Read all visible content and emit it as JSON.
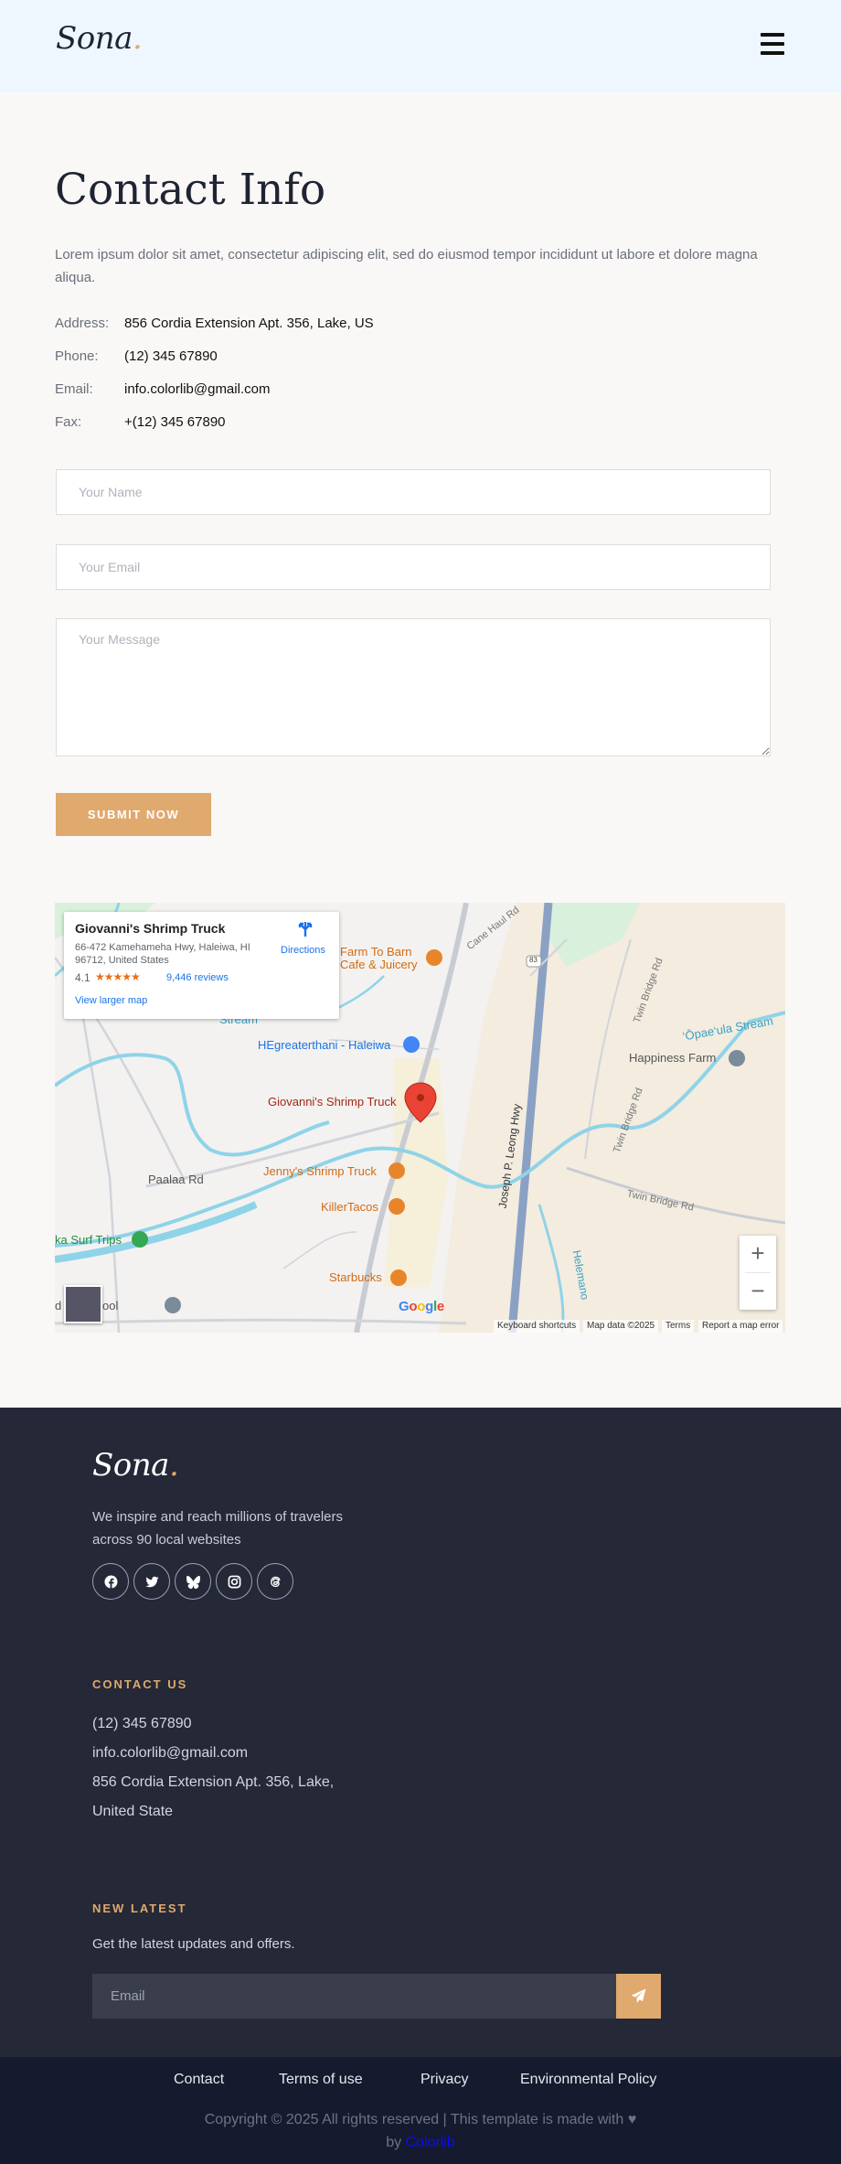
{
  "header": {
    "logo": "Sona",
    "logo_dot": "."
  },
  "contact": {
    "title": "Contact Info",
    "intro": "Lorem ipsum dolor sit amet, consectetur adipiscing elit, sed do eiusmod tempor incididunt ut labore et dolore magna aliqua.",
    "rows": [
      {
        "label": "Address:",
        "value": "856 Cordia Extension Apt. 356, Lake, US"
      },
      {
        "label": "Phone:",
        "value": "(12) 345 67890"
      },
      {
        "label": "Email:",
        "value": "info.colorlib@gmail.com"
      },
      {
        "label": "Fax:",
        "value": "+(12) 345 67890"
      }
    ]
  },
  "form": {
    "name_placeholder": "Your Name",
    "email_placeholder": "Your Email",
    "message_placeholder": "Your Message",
    "submit_label": "SUBMIT NOW"
  },
  "map": {
    "card": {
      "place": "Giovanni's Shrimp Truck",
      "address": "66-472 Kamehameha Hwy, Haleiwa, HI 96712, United States",
      "rating": "4.1",
      "stars": "★★★★★",
      "reviews": "9,446 reviews",
      "larger_map": "View larger map",
      "directions": "Directions"
    },
    "labels": {
      "farm_to_barn_1": "Farm To Barn",
      "farm_to_barn_2": "Cafe & Juicery",
      "cane_haul": "Cane Haul Rd",
      "twin_bridge_rd": "Twin Bridge Rd",
      "twin_bridge_rd2": "Twin Bridge Rd",
      "twin_bridge_rd3": "Twin Bridge Rd",
      "opaeula": "‘Ōpae‘ula Stream",
      "happiness": "Happiness Farm",
      "stream": "Stream",
      "hegreater": "HEgreaterthani - Haleiwa",
      "giovanni": "Giovanni's Shrimp Truck",
      "paalaa": "Paalaa Rd",
      "jenny": "Jenny's Shrimp Truck",
      "killer": "KillerTacos",
      "joseph": "Joseph P. Leong Hwy",
      "surf_trips": "ka Surf Trips",
      "starbucks": "Starbucks",
      "surf_school": "d    urf School",
      "helemano": "Helemano",
      "route": "83"
    },
    "google": "Google",
    "footer": {
      "keyboard": "Keyboard shortcuts",
      "mapdata": "Map data ©2025",
      "terms": "Terms",
      "report": "Report a map error"
    },
    "zoom_in": "+",
    "zoom_out": "−",
    "colors": {
      "water": "#8fd3e8",
      "road": "#c8ccd2",
      "highway": "#8aa1c4",
      "pin": "#ea4335",
      "poi_orange": "#e8852b"
    }
  },
  "footer": {
    "logo": "Sona",
    "logo_dot": ".",
    "tagline": "We inspire and reach millions of travelers across 90 local websites",
    "socials": [
      "facebook-icon",
      "twitter-icon",
      "bluesky-icon",
      "instagram-icon",
      "threads-icon"
    ],
    "contact_heading": "CONTACT US",
    "phone": "(12) 345 67890",
    "email": "info.colorlib@gmail.com",
    "address_1": "856 Cordia Extension Apt. 356, Lake,",
    "address_2": "United State",
    "news_heading": "NEW LATEST",
    "news_text": "Get the latest updates and offers.",
    "email_placeholder": "Email"
  },
  "bottom": {
    "links": [
      "Contact",
      "Terms of use",
      "Privacy",
      "Environmental Policy"
    ],
    "copyright": "Copyright © 2025 All rights reserved | This template is made with",
    "by": "by",
    "colorlib": "Colorlib"
  },
  "accent": "#e0a96d"
}
